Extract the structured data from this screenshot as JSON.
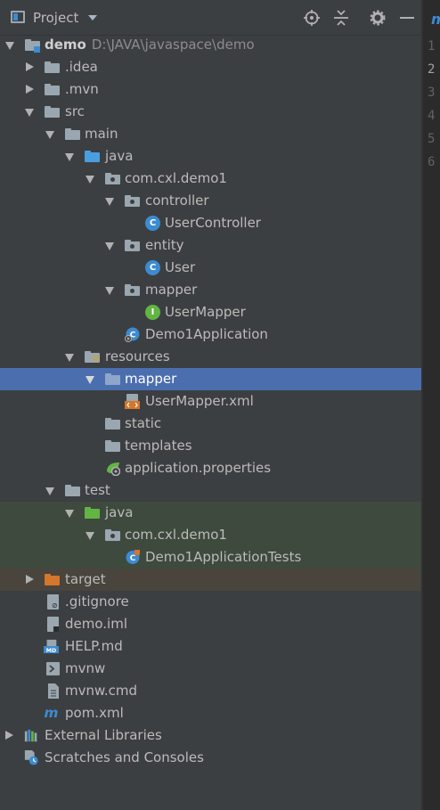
{
  "toolbar": {
    "title": "Project",
    "buttons": [
      {
        "name": "locate-icon"
      },
      {
        "name": "collapse-all-icon"
      },
      {
        "name": "settings-gear-icon"
      },
      {
        "name": "hide-minus-icon"
      }
    ]
  },
  "gutter": {
    "lines": [
      "1",
      "2",
      "3",
      "4",
      "5",
      "6"
    ],
    "active_line": "2"
  },
  "editor_glyph": "m",
  "tree": {
    "root": {
      "label": "demo",
      "path": "D:\\JAVA\\javaspace\\demo"
    },
    "idea": ".idea",
    "mvn": ".mvn",
    "src": "src",
    "main": "main",
    "java": "java",
    "package": "com.cxl.demo1",
    "controller": "controller",
    "user_controller": "UserController",
    "entity": "entity",
    "user": "User",
    "mapper": "mapper",
    "user_mapper": "UserMapper",
    "demo1_application": "Demo1Application",
    "resources": "resources",
    "res_mapper": "mapper",
    "user_mapper_xml": "UserMapper.xml",
    "static": "static",
    "templates": "templates",
    "app_properties": "application.properties",
    "test": "test",
    "test_java": "java",
    "test_package": "com.cxl.demo1",
    "demo1_tests": "Demo1ApplicationTests",
    "target": "target",
    "gitignore": ".gitignore",
    "demo_iml": "demo.iml",
    "help_md": "HELP.md",
    "mvnw": "mvnw",
    "mvnw_cmd": "mvnw.cmd",
    "pom_xml": "pom.xml",
    "external_libraries": "External Libraries",
    "scratches": "Scratches and Consoles"
  },
  "colors": {
    "panel_bg": "#3c3f41",
    "selection": "#4b6eaf",
    "test_bg": "#3e4a3d",
    "excluded_bg": "#49443c",
    "class_icon": "#3d8bd1",
    "interface_icon": "#62b543"
  }
}
